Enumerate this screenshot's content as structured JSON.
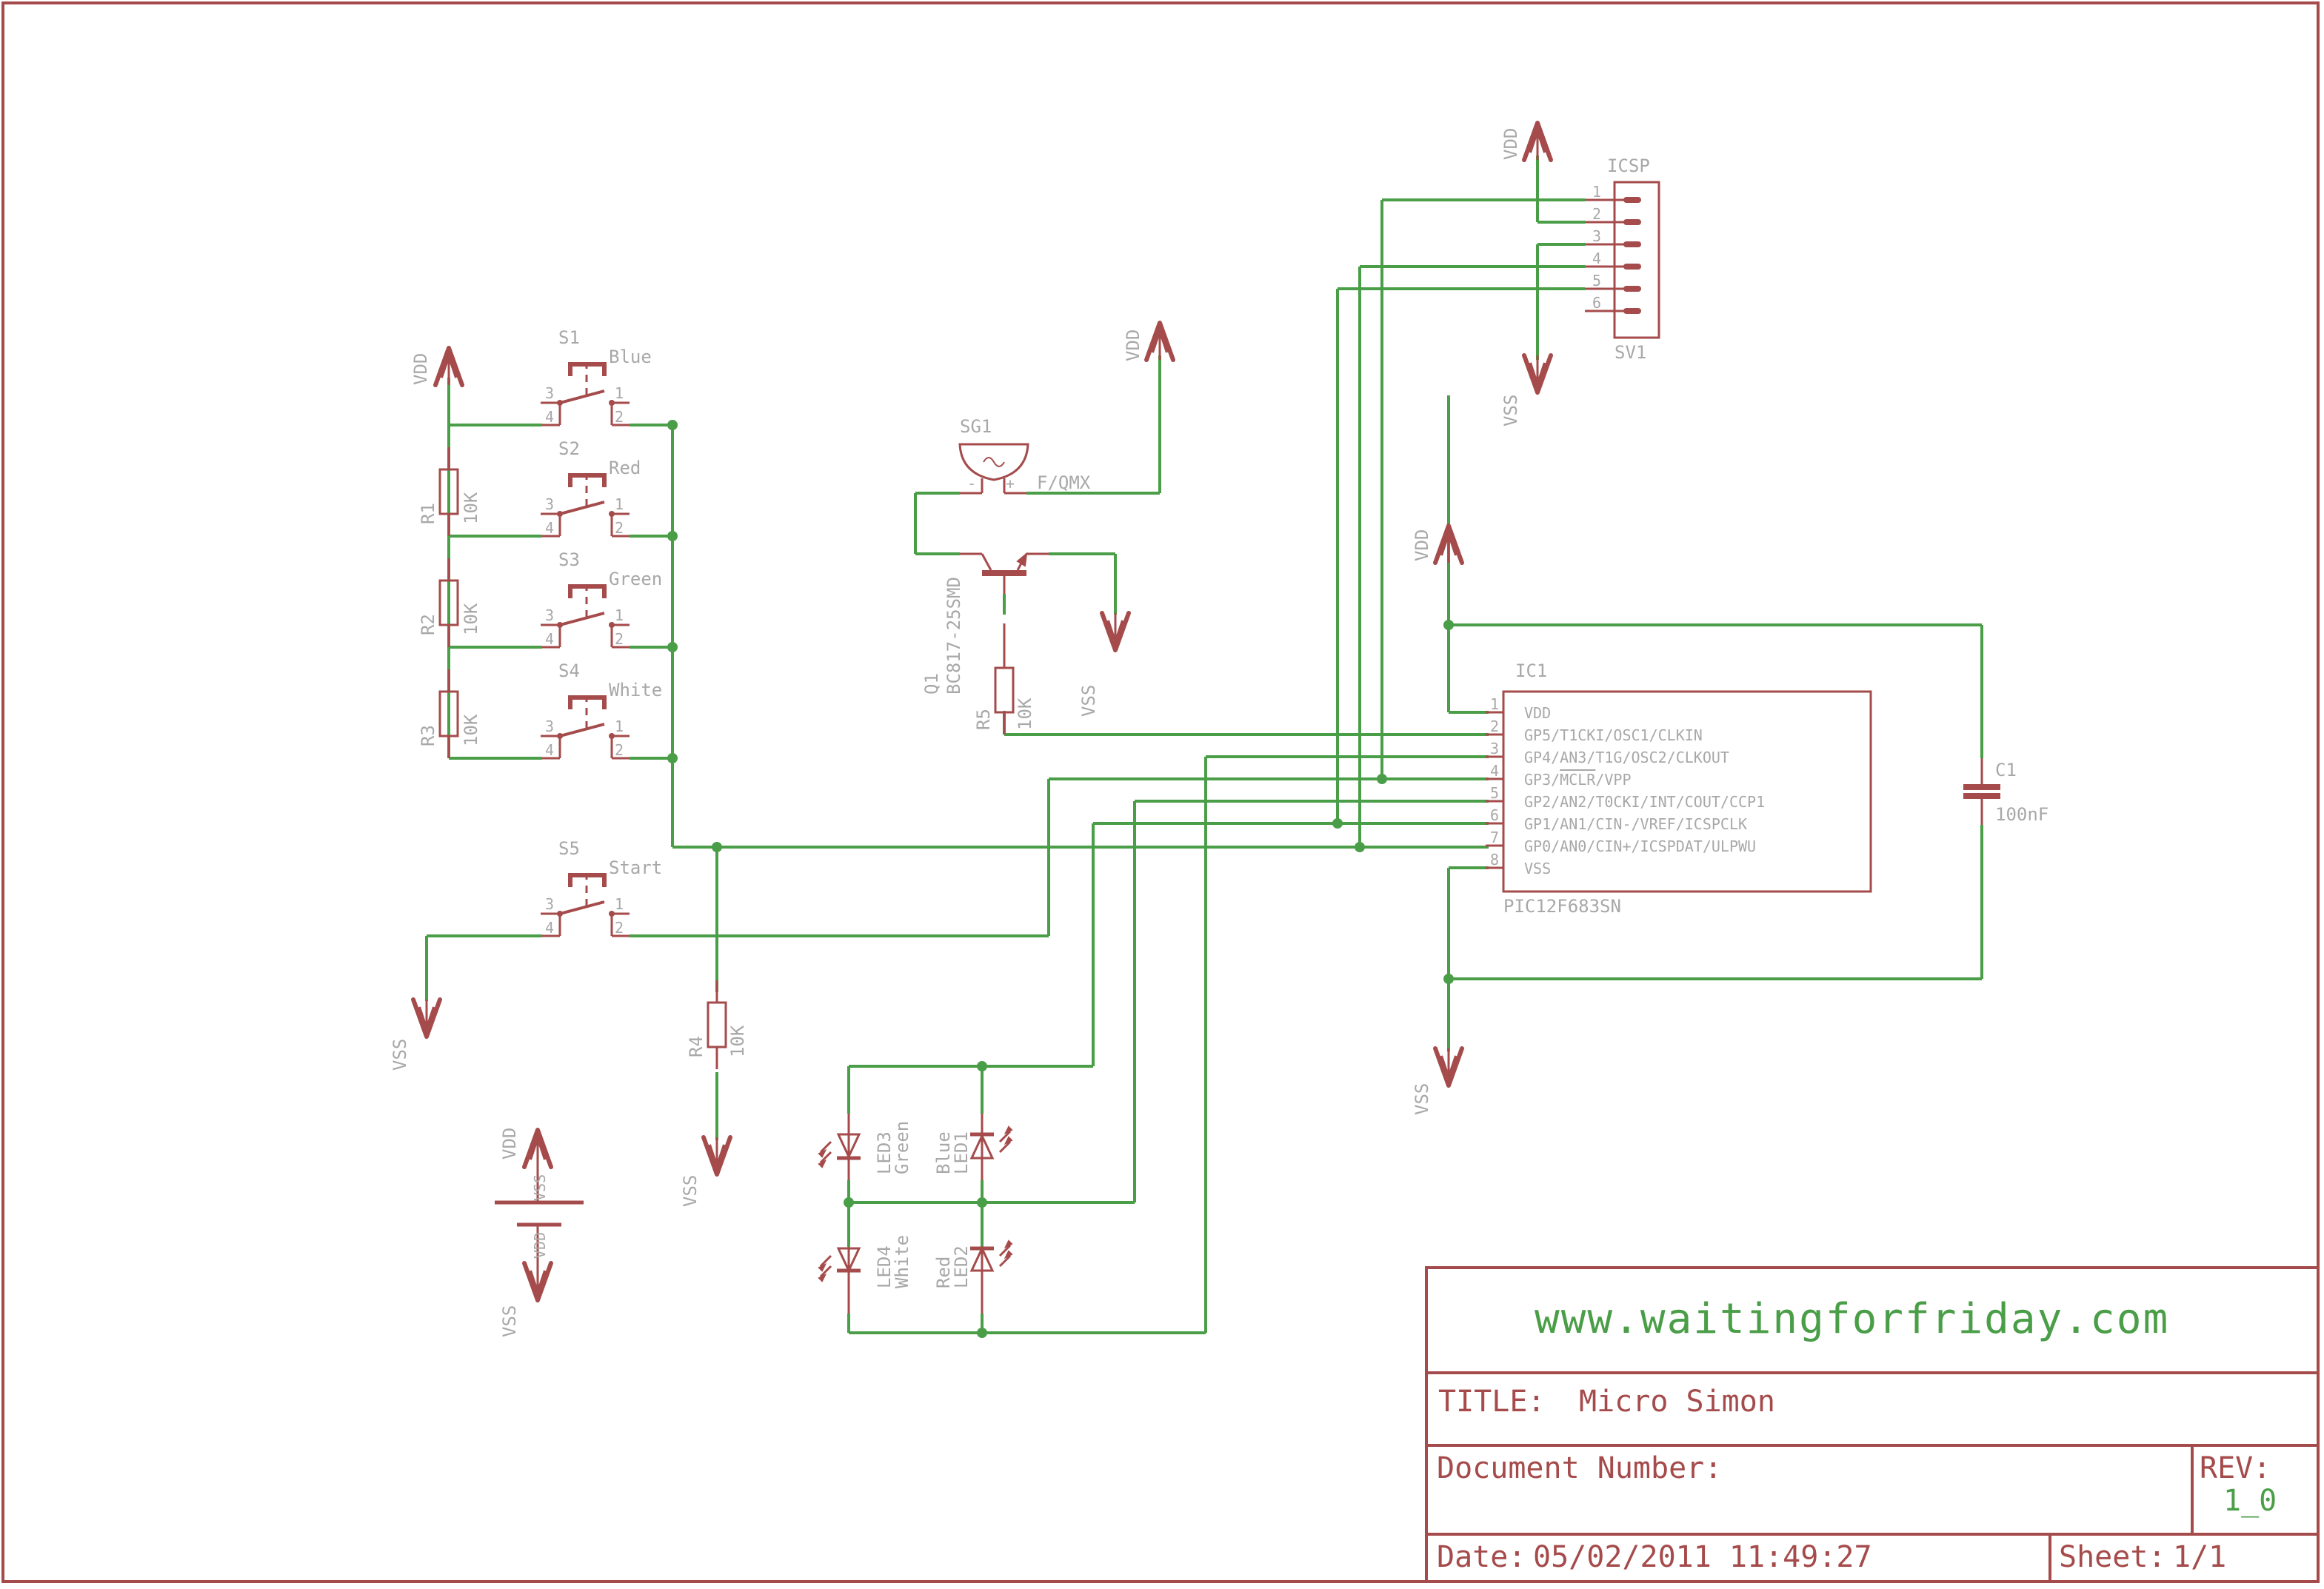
{
  "title_block": {
    "url": "www.waitingforfriday.com",
    "title_label": "TITLE:",
    "title_value": "Micro Simon",
    "document_number_label": "Document Number:",
    "document_number_value": "",
    "rev_label": "REV:",
    "rev_value": "1_0",
    "date_label": "Date:",
    "date_value": "05/02/2011 11:49:27",
    "sheet_label": "Sheet:",
    "sheet_value": "1/1"
  },
  "supplies": {
    "vdd": "VDD",
    "vss": "VSS"
  },
  "ic1": {
    "ref": "IC1",
    "value": "PIC12F683SN",
    "pins": [
      {
        "num": "1",
        "name": "VDD"
      },
      {
        "num": "2",
        "name": "GP5/T1CKI/OSC1/CLKIN"
      },
      {
        "num": "3",
        "name": "GP4/AN3/T1G/OSC2/CLKOUT"
      },
      {
        "num": "4",
        "name": "GP3/MCLR/VPP"
      },
      {
        "num": "5",
        "name": "GP2/AN2/T0CKI/INT/COUT/CCP1"
      },
      {
        "num": "6",
        "name": "GP1/AN1/CIN-/VREF/ICSPCLK"
      },
      {
        "num": "7",
        "name": "GP0/AN0/CIN+/ICSPDAT/ULPWU"
      },
      {
        "num": "8",
        "name": "VSS"
      }
    ],
    "pin4_prefix": "GP3/",
    "pin4_overbar": "MCLR",
    "pin4_suffix": "/VPP"
  },
  "icsp": {
    "ref": "SV1",
    "value": "ICSP",
    "pins": [
      "1",
      "2",
      "3",
      "4",
      "5",
      "6"
    ]
  },
  "switches": [
    {
      "ref": "S1",
      "label": "Blue"
    },
    {
      "ref": "S2",
      "label": "Red"
    },
    {
      "ref": "S3",
      "label": "Green"
    },
    {
      "ref": "S4",
      "label": "White"
    },
    {
      "ref": "S5",
      "label": "Start"
    }
  ],
  "switch_pins": {
    "p1": "1",
    "p2": "2",
    "p3": "3",
    "p4": "4"
  },
  "resistors": [
    {
      "ref": "R1",
      "value": "10K"
    },
    {
      "ref": "R2",
      "value": "10K"
    },
    {
      "ref": "R3",
      "value": "10K"
    },
    {
      "ref": "R4",
      "value": "10K"
    },
    {
      "ref": "R5",
      "value": "10K"
    }
  ],
  "buzzer": {
    "ref": "SG1",
    "value": "F/QMX",
    "minus": "-",
    "plus": "+"
  },
  "transistor": {
    "ref": "Q1",
    "value": "BC817-25SMD"
  },
  "capacitor": {
    "ref": "C1",
    "value": "100nF"
  },
  "leds": [
    {
      "ref": "LED1",
      "label": "Blue"
    },
    {
      "ref": "LED2",
      "label": "Red"
    },
    {
      "ref": "LED3",
      "label": "Green"
    },
    {
      "ref": "LED4",
      "label": "White"
    }
  ],
  "power_symbol": {
    "top_pin": "VSS",
    "bottom_pin": "VDD"
  }
}
